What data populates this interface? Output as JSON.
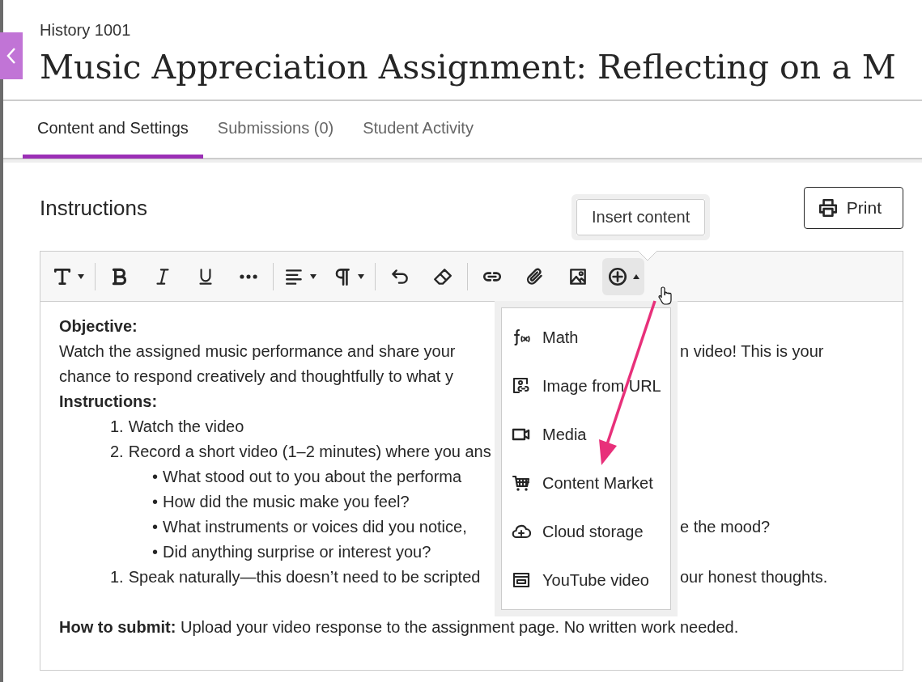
{
  "course": "History 1001",
  "title": "Music Appreciation Assignment: Reflecting on a M",
  "tabs": [
    {
      "label": "Content and Settings",
      "selected": true
    },
    {
      "label": "Submissions (0)",
      "selected": false
    },
    {
      "label": "Student Activity",
      "selected": false
    }
  ],
  "section_title": "Instructions",
  "print_button": "Print",
  "tooltip": "Insert content",
  "toolbar": [
    {
      "kind": "text-style",
      "caret": true,
      "pressed": false
    },
    {
      "kind": "separator"
    },
    {
      "kind": "bold",
      "caret": false,
      "pressed": false
    },
    {
      "kind": "italic",
      "caret": false,
      "pressed": false
    },
    {
      "kind": "underline",
      "caret": false,
      "pressed": false
    },
    {
      "kind": "more",
      "caret": false,
      "pressed": false
    },
    {
      "kind": "separator"
    },
    {
      "kind": "align",
      "caret": true,
      "pressed": false
    },
    {
      "kind": "paragraph",
      "caret": true,
      "pressed": false
    },
    {
      "kind": "separator"
    },
    {
      "kind": "undo",
      "caret": false,
      "pressed": false
    },
    {
      "kind": "eraser",
      "caret": false,
      "pressed": false
    },
    {
      "kind": "separator"
    },
    {
      "kind": "link",
      "caret": false,
      "pressed": false
    },
    {
      "kind": "attach",
      "caret": false,
      "pressed": false
    },
    {
      "kind": "image",
      "caret": false,
      "pressed": false
    },
    {
      "kind": "insert",
      "caret": true,
      "pressed": true
    }
  ],
  "body_lines": [
    {
      "kind": "heading",
      "text": "Objective:"
    },
    {
      "kind": "para",
      "text": "Watch the assigned music performance and share your",
      "text_right": "n video! This is your"
    },
    {
      "kind": "para",
      "text": "chance to respond creatively and thoughtfully to what y"
    },
    {
      "kind": "heading",
      "text": "Instructions:"
    },
    {
      "kind": "numbered",
      "marker": "1.",
      "text": "Watch the video"
    },
    {
      "kind": "numbered",
      "marker": "2.",
      "text": "Record a short video (1–2 minutes) where you ans"
    },
    {
      "kind": "bullet",
      "marker": "•",
      "text": "What stood out to you about the performa"
    },
    {
      "kind": "bullet",
      "marker": "•",
      "text": "How did the music make you feel?"
    },
    {
      "kind": "bullet",
      "marker": "•",
      "text": "What instruments or voices did you notice,",
      "text_right": "e the mood?"
    },
    {
      "kind": "bullet",
      "marker": "•",
      "text": "Did anything surprise or interest you?"
    },
    {
      "kind": "numbered",
      "marker": "1.",
      "text": "Speak naturally—this doesn’t need to be scripted",
      "text_right": "our honest thoughts."
    },
    {
      "kind": "spaced_para",
      "text": "**How to submit:** Upload your video response to the assignment page. No written work needed."
    }
  ],
  "insert_menu": [
    {
      "kind": "math",
      "label": "Math"
    },
    {
      "kind": "image-url",
      "label": "Image from URL"
    },
    {
      "kind": "media",
      "label": "Media"
    },
    {
      "kind": "market",
      "label": "Content Market"
    },
    {
      "kind": "cloud",
      "label": "Cloud storage"
    },
    {
      "kind": "youtube",
      "label": "YouTube video"
    }
  ]
}
